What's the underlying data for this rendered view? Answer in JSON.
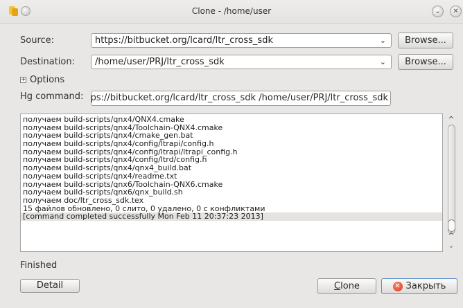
{
  "window": {
    "title": "Clone - /home/user"
  },
  "form": {
    "source_label": "Source:",
    "source_value": "https://bitbucket.org/lcard/ltr_cross_sdk",
    "destination_label": "Destination:",
    "destination_value": "/home/user/PRJ/ltr_cross_sdk",
    "browse_label": "Browse...",
    "options_label": "Options",
    "hg_command_label": "Hg command:",
    "hg_command_value": "hg clone --verbose -- https://bitbucket.org/lcard/ltr_cross_sdk /home/user/PRJ/ltr_cross_sdk"
  },
  "log": {
    "lines": [
      "получаем build-scripts/qnx4/QNX4.cmake",
      "получаем build-scripts/qnx4/Toolchain-QNX4.cmake",
      "получаем build-scripts/qnx4/cmake_gen.bat",
      "получаем build-scripts/qnx4/config/ltrapi/config.h",
      "получаем build-scripts/qnx4/config/ltrapi/ltrapi_config.h",
      "получаем build-scripts/qnx4/config/ltrd/config.h",
      "получаем build-scripts/qnx4/qnx4_build.bat",
      "получаем build-scripts/qnx4/readme.txt",
      "получаем build-scripts/qnx6/Toolchain-QNX6.cmake",
      "получаем build-scripts/qnx6/qnx_build.sh",
      "получаем doc/ltr_cross_sdk.tex",
      "15 файлов обновлено, 0 слито, 0 удалено, 0 с конфликтами",
      "[command completed successfully Mon Feb 11 20:37:23 2013]"
    ]
  },
  "status": {
    "text": "Finished"
  },
  "buttons": {
    "detail": "Detail",
    "clone_first": "C",
    "clone_rest": "lone",
    "close": "Закрыть"
  },
  "icons": {
    "app": "tortoisehg-icon",
    "window_menu": "window-menu-icon",
    "minimize": "minimize-icon",
    "close_window": "close-window-icon",
    "dropdown": "chevron-down-icon",
    "expand": "plus-box-icon",
    "scroll_up": "scroll-up-icon",
    "scroll_down": "scroll-down-icon",
    "close_dialog": "close-dialog-icon"
  },
  "colors": {
    "window_bg": "#e8e7e5",
    "close_icon": "#d7301a",
    "app_icon": "#f2b01e"
  }
}
